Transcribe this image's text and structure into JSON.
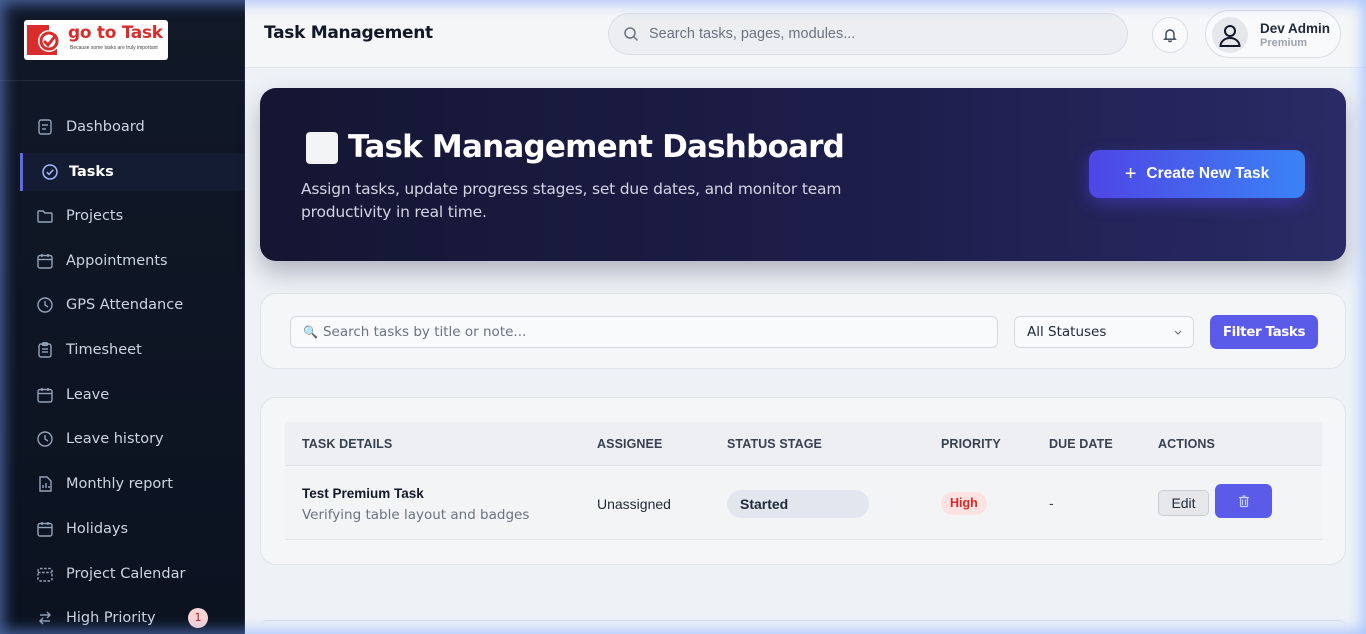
{
  "brand": {
    "logo_text": "go to Task",
    "tagline": "Because some tasks are truly important"
  },
  "sidebar": {
    "items": [
      {
        "label": "Dashboard",
        "icon": "dashboard-icon"
      },
      {
        "label": "Tasks",
        "icon": "check-circle-icon",
        "active": true
      },
      {
        "label": "Projects",
        "icon": "folder-icon"
      },
      {
        "label": "Appointments",
        "icon": "calendar-icon"
      },
      {
        "label": "GPS Attendance",
        "icon": "clock-icon"
      },
      {
        "label": "Timesheet",
        "icon": "clipboard-icon"
      },
      {
        "label": "Leave",
        "icon": "calendar-icon"
      },
      {
        "label": "Leave history",
        "icon": "clock-icon"
      },
      {
        "label": "Monthly report",
        "icon": "report-icon"
      },
      {
        "label": "Holidays",
        "icon": "calendar-icon"
      },
      {
        "label": "Project Calendar",
        "icon": "calendar-dashed-icon"
      },
      {
        "label": "High Priority",
        "icon": "swap-arrows-icon",
        "badge": "1"
      }
    ]
  },
  "header": {
    "title": "Task Management",
    "search_placeholder": "Search tasks, pages, modules...",
    "user_name": "Dev Admin",
    "user_plan": "Premium"
  },
  "hero": {
    "title": "Task Management Dashboard",
    "subtitle": "Assign tasks, update progress stages, set due dates, and monitor team productivity in real time.",
    "create_label": "Create New Task"
  },
  "filters": {
    "search_placeholder": "Search tasks by title or note...",
    "status_selected": "All Statuses",
    "filter_label": "Filter Tasks"
  },
  "table": {
    "headers": [
      "TASK DETAILS",
      "ASSIGNEE",
      "STATUS STAGE",
      "PRIORITY",
      "DUE DATE",
      "ACTIONS"
    ],
    "rows": [
      {
        "title": "Test Premium Task",
        "note": "Verifying table layout and badges",
        "assignee": "Unassigned",
        "status": "Started",
        "priority": "High",
        "due": "-",
        "edit_label": "Edit"
      }
    ]
  },
  "colors": {
    "accent": "#5b5bea",
    "sidebar_bg": "#111827",
    "hero_bg": "#1d1d4a",
    "priority_high": "#dc2626"
  }
}
